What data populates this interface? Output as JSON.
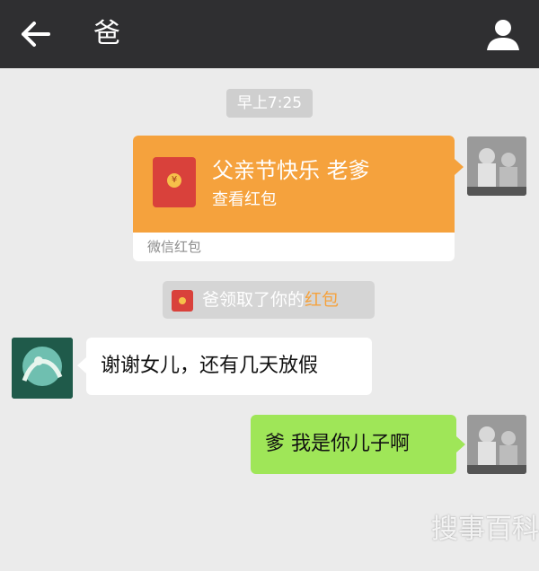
{
  "header": {
    "title": "爸",
    "back_icon": "arrow-left-icon",
    "profile_icon": "user-icon",
    "background_color": "#2f2f31"
  },
  "chat": {
    "timestamp": "早上7:25",
    "red_packet": {
      "greeting": "父亲节快乐  老爹",
      "action": "查看红包",
      "footer": "微信红包",
      "seal_char": "¥",
      "color": "#f5a23d"
    },
    "system_notice": {
      "prefix": "爸领取了你的",
      "link": "红包",
      "icon": "red-packet-icon"
    },
    "messages": [
      {
        "from": "dad",
        "text": "谢谢女儿，还有几天放假"
      },
      {
        "from": "me",
        "text": "爹  我是你儿子啊"
      }
    ]
  },
  "watermark": "搜事百科"
}
